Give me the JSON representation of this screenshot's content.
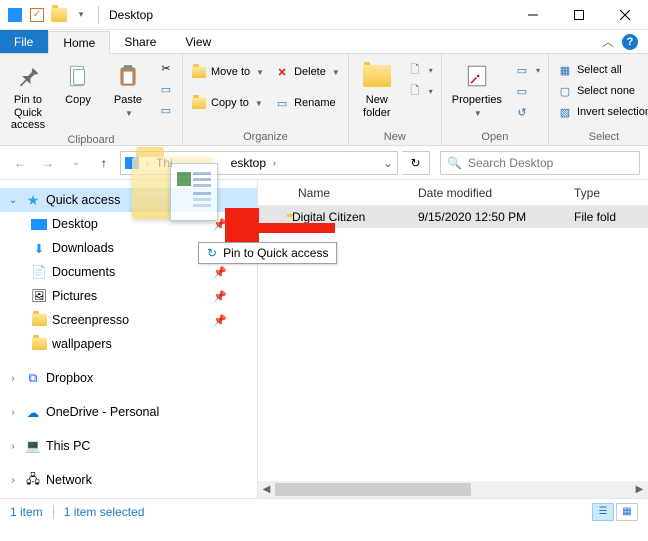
{
  "title": "Desktop",
  "tabs": {
    "file": "File",
    "home": "Home",
    "share": "Share",
    "view": "View"
  },
  "ribbon": {
    "clipboard": {
      "label": "Clipboard",
      "pin": "Pin to Quick\naccess",
      "copy": "Copy",
      "paste": "Paste"
    },
    "organize": {
      "label": "Organize",
      "moveto": "Move to",
      "copyto": "Copy to",
      "delete": "Delete",
      "rename": "Rename"
    },
    "new_group": {
      "label": "New",
      "newfolder": "New\nfolder"
    },
    "open_group": {
      "label": "Open",
      "properties": "Properties"
    },
    "select_group": {
      "label": "Select",
      "all": "Select all",
      "none": "Select none",
      "invert": "Invert selection"
    }
  },
  "address": {
    "seg1": "Thi",
    "seg2": "esktop",
    "refresh_glyph": "↻"
  },
  "search": {
    "placeholder": "Search Desktop",
    "icon": "🔍"
  },
  "nav": {
    "quick_access": "Quick access",
    "desktop": "Desktop",
    "downloads": "Downloads",
    "documents": "Documents",
    "pictures": "Pictures",
    "screenpresso": "Screenpresso",
    "wallpapers": "wallpapers",
    "dropbox": "Dropbox",
    "onedrive": "OneDrive - Personal",
    "thispc": "This PC",
    "network": "Network"
  },
  "columns": {
    "name": "Name",
    "date": "Date modified",
    "type": "Type"
  },
  "rows": [
    {
      "name": "Digital Citizen",
      "date": "9/15/2020 12:50 PM",
      "type": "File fold"
    }
  ],
  "drag_tooltip": "Pin to Quick access",
  "status": {
    "count": "1 item",
    "selected": "1 item selected"
  }
}
